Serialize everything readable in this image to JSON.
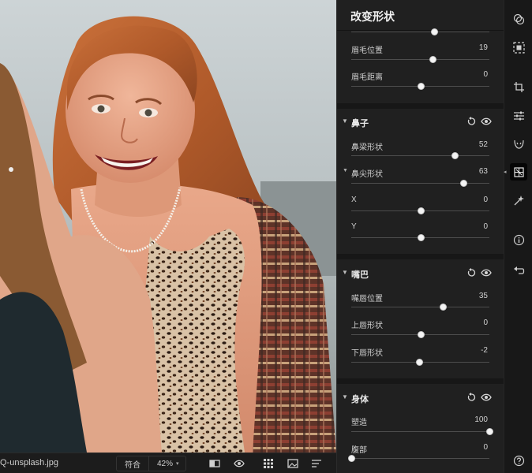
{
  "photo": {
    "filename": "Q-unsplash.jpg"
  },
  "bottombar": {
    "fit_label": "符合",
    "zoom_value": "42%"
  },
  "panel": {
    "title": "改变形状",
    "top_partial_value": "",
    "eyebrow_rows": [
      {
        "label": "眉毛位置",
        "value": "19",
        "level": 0.59
      },
      {
        "label": "眉毛距离",
        "value": "0",
        "level": 0.5
      }
    ],
    "groups": [
      {
        "title": "鼻子",
        "rows": [
          {
            "label": "鼻梁形状",
            "value": "52",
            "level": 0.75
          },
          {
            "label": "鼻尖形状",
            "value": "63",
            "level": 0.81
          },
          {
            "label": "X",
            "value": "0",
            "level": 0.5
          },
          {
            "label": "Y",
            "value": "0",
            "level": 0.5
          }
        ]
      },
      {
        "title": "嘴巴",
        "rows": [
          {
            "label": "嘴唇位置",
            "value": "35",
            "level": 0.66
          },
          {
            "label": "上唇形状",
            "value": "0",
            "level": 0.5
          },
          {
            "label": "下唇形状",
            "value": "-2",
            "level": 0.49
          }
        ]
      },
      {
        "title": "身体",
        "rows": [
          {
            "label": "塑造",
            "value": "100",
            "level": 1.0
          },
          {
            "label": "腹部",
            "value": "0",
            "level": 0.0
          }
        ]
      }
    ]
  },
  "rail": {
    "icons": [
      "layers-icon",
      "select-subject-icon",
      "crop-icon",
      "sliders-icon",
      "face-icon",
      "reshape-icon",
      "magic-icon",
      "info-icon",
      "undo-icon",
      "help-icon"
    ],
    "active": "reshape-icon"
  },
  "colors": {
    "panel_bg": "#202020",
    "rail_bg": "#181818",
    "knob": "#f4f4f4"
  }
}
